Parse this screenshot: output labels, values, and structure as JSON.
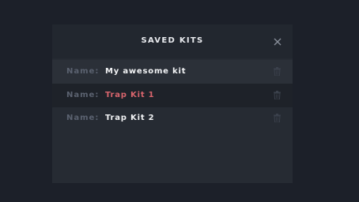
{
  "modal": {
    "title": "SAVED KITS",
    "close_icon": "close-icon"
  },
  "kits": [
    {
      "label": "Name:",
      "name": "My awesome kit",
      "delete_icon": "trash-icon"
    },
    {
      "label": "Name:",
      "name": "Trap Kit 1",
      "delete_icon": "trash-icon",
      "highlighted": true,
      "highlight_color": "#d9656d"
    },
    {
      "label": "Name:",
      "name": "Trap Kit 2",
      "delete_icon": "trash-icon"
    }
  ]
}
